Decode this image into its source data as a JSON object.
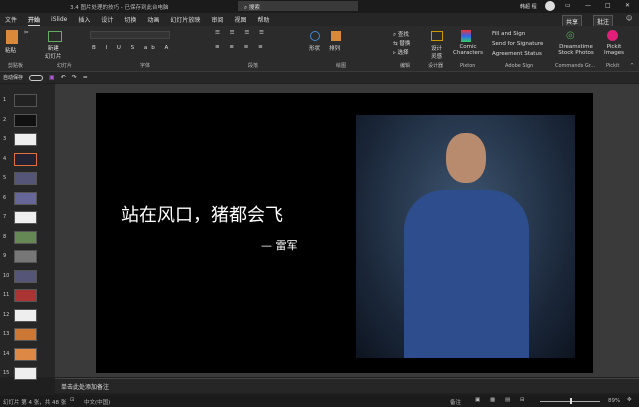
{
  "titlebar": {
    "title": "3.4 图片处理的技巧 - 已保存到此台电脑",
    "search_placeholder": "搜索",
    "user": "韩超 程"
  },
  "tabs": [
    "文件",
    "开始",
    "iSlide",
    "插入",
    "设计",
    "切换",
    "动画",
    "幻灯片放映",
    "审阅",
    "视图",
    "帮助"
  ],
  "ribbon": {
    "share": "共享",
    "comment": "批注",
    "paste": "粘贴",
    "new_slide": "新建\n幻灯片",
    "shape": "形状",
    "arrange": "排列",
    "find": "查找",
    "replace": "替换",
    "select": "选择",
    "designer": "设计\n灵感",
    "comic": "Comic Characters",
    "fill_sign": "Fill and Sign",
    "send_sig": "Send for Signature",
    "agreement": "Agreement Status",
    "dreamstime": "Dreamstime Stock Photos",
    "pickit": "Pickit Images",
    "groups": [
      "剪贴板",
      "幻灯片",
      "字体",
      "段落",
      "绘图",
      "编辑",
      "设计器",
      "Pixton",
      "Adobe Sign",
      "Commands Gr...",
      "Pickit"
    ]
  },
  "qat": {
    "autosave": "自动保存"
  },
  "thumbnails": [
    "1",
    "2",
    "3",
    "4",
    "5",
    "6",
    "7",
    "8",
    "9",
    "10",
    "11",
    "12",
    "13",
    "14",
    "15"
  ],
  "slide": {
    "quote": "站在风口，猪都会飞",
    "author": "— 雷军"
  },
  "notes": {
    "placeholder": "单击此处添加备注"
  },
  "status": {
    "slide_info": "幻灯片 第 4 张，共 48 张",
    "language": "中文(中国)",
    "notes": "备注",
    "zoom": "89%"
  }
}
